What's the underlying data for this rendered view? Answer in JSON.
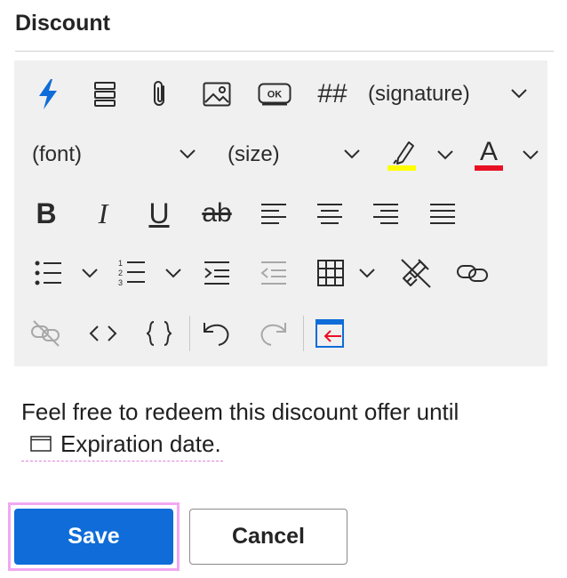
{
  "section": {
    "title": "Discount"
  },
  "toolbar": {
    "signature_label": "(signature)",
    "font_label": "(font)",
    "size_label": "(size)",
    "hash_label": "##",
    "button_icon_label": "OK",
    "bold_label": "B",
    "italic_label": "I",
    "underline_label": "U",
    "strike_label": "ab",
    "font_color_label": "A",
    "highlight_color": "#ffff00",
    "font_color": "#e81123",
    "accent_icon_color": "#0f6cd8"
  },
  "editor": {
    "text": "Feel free to redeem this discount offer until",
    "placeholder_label": "Expiration date."
  },
  "actions": {
    "save_label": "Save",
    "cancel_label": "Cancel"
  },
  "colors": {
    "primary": "#0f6cd8",
    "toolbar_bg": "#f0f0f0",
    "focus_outline": "#f2a7f2"
  }
}
